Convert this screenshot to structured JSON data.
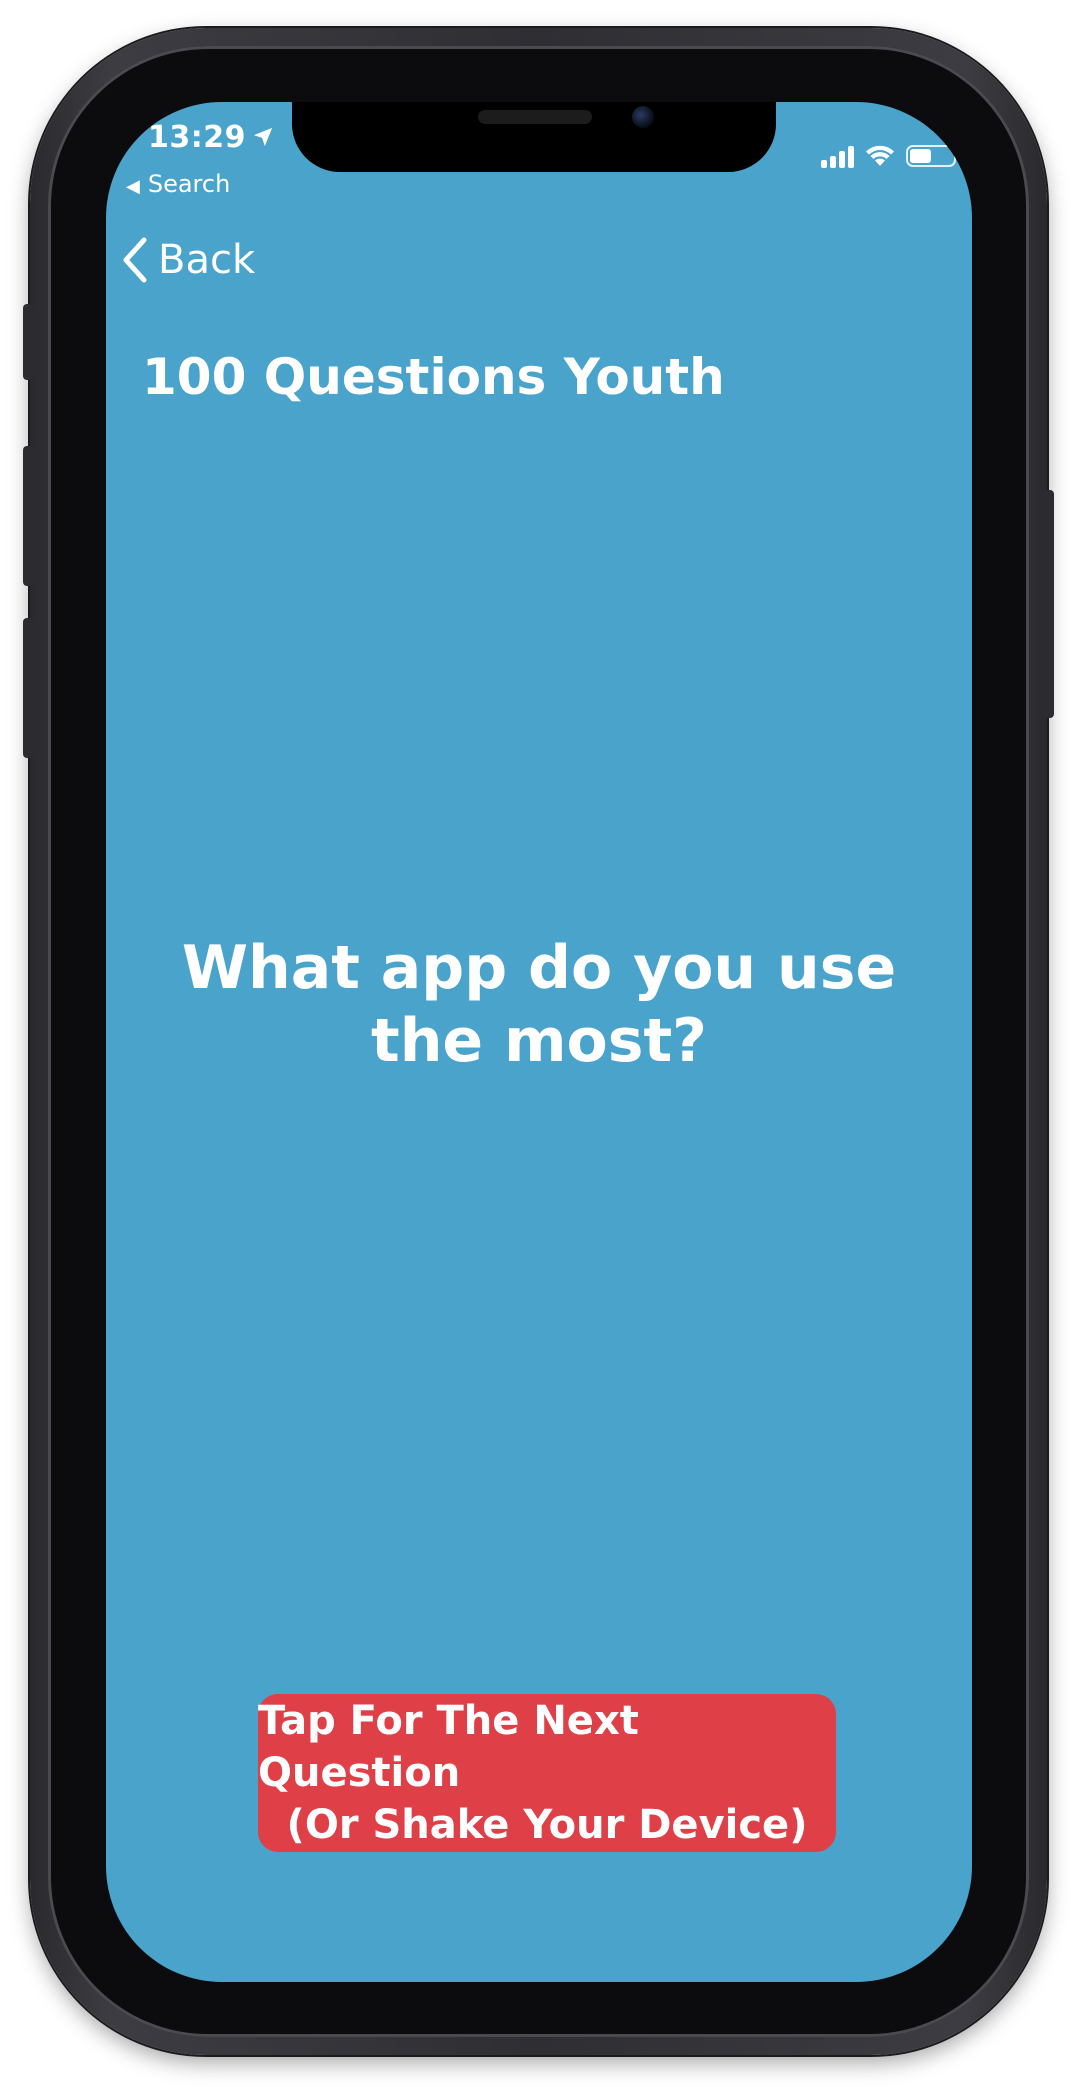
{
  "status_bar": {
    "time": "13:29",
    "back_app_label": "Search",
    "battery_level": 0.5
  },
  "nav": {
    "back_label": "Back"
  },
  "header": {
    "title": "100 Questions Youth"
  },
  "main": {
    "question_line1": "What app do you use",
    "question_line2": "the most?"
  },
  "action": {
    "line1": "Tap For The Next Question",
    "line2": "(Or Shake Your Device)"
  },
  "colors": {
    "background": "#4aa3cb",
    "button": "#df4047",
    "text": "#ffffff"
  },
  "icons": [
    "location-arrow-icon",
    "back-triangle-icon",
    "signal-icon",
    "wifi-icon",
    "battery-icon",
    "chevron-left-icon"
  ]
}
